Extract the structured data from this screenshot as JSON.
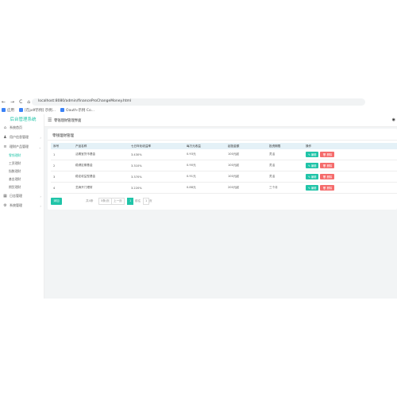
{
  "browser": {
    "nav": {
      "back": "←",
      "forward": "→",
      "reload": "C",
      "home": "⌂"
    },
    "url": "localhost:8080/admin/financeProChangeMoney.html",
    "bookmarks": [
      {
        "label": "应用"
      },
      {
        "label": "[在pdf示例] 示例..."
      },
      {
        "label": "Oauth-示例 Co..."
      }
    ]
  },
  "sidebar": {
    "logo": "后台管理系统",
    "items": [
      {
        "icon": "home-icon",
        "label": "系统首页"
      },
      {
        "icon": "users-icon",
        "label": "用户信息管理",
        "arrow": "›"
      },
      {
        "icon": "chart-icon",
        "label": "理财产品管理",
        "arrow": "⌄"
      }
    ],
    "subitems": [
      {
        "label": "零钱理财",
        "active": true
      },
      {
        "label": "工资理财",
        "active": false
      },
      {
        "label": "指数理财",
        "active": false
      },
      {
        "label": "基金理财",
        "active": false
      },
      {
        "label": "期货理财",
        "active": false
      }
    ],
    "items_bottom": [
      {
        "icon": "grid-icon",
        "label": "日志管理",
        "arrow": "›"
      },
      {
        "icon": "settings-icon",
        "label": "系统管理",
        "arrow": "›"
      }
    ]
  },
  "header": {
    "menu_icon": "☰",
    "title": "零钱理财管理界面",
    "right_icon": "◉"
  },
  "card": {
    "title": "零钱理财管理"
  },
  "table": {
    "columns": [
      "序号",
      "产品名称",
      "七日年化收益率",
      "每万元收益",
      "起投金额",
      "投资期限",
      "操作"
    ],
    "rows": [
      [
        "1",
        "活期宝货币基金",
        "3.430%",
        "0.93元",
        "100元起",
        "灵活"
      ],
      [
        "2",
        "稳健定期基金",
        "3.310%",
        "0.90元",
        "100元起",
        "灵活"
      ],
      [
        "3",
        "稳定收益型基金",
        "3.370%",
        "0.91元",
        "100元起",
        "灵活"
      ],
      [
        "4",
        "芝麻开门理财",
        "3.220%",
        "0.88元",
        "200元起",
        "三个月"
      ]
    ],
    "edit_label": "✎ 编辑",
    "delete_label": "🗑 删除"
  },
  "pager": {
    "add_label": "添加",
    "total_text": "共4条",
    "page_size": "5条/页",
    "prev_label": "上一页",
    "current_page": "1",
    "jump_prefix": "前往",
    "jump_value": "1",
    "jump_suffix": "页"
  },
  "colors": {
    "accent": "#20c4a8",
    "danger": "#f56c6c",
    "table_header": "#e4f1f7"
  }
}
